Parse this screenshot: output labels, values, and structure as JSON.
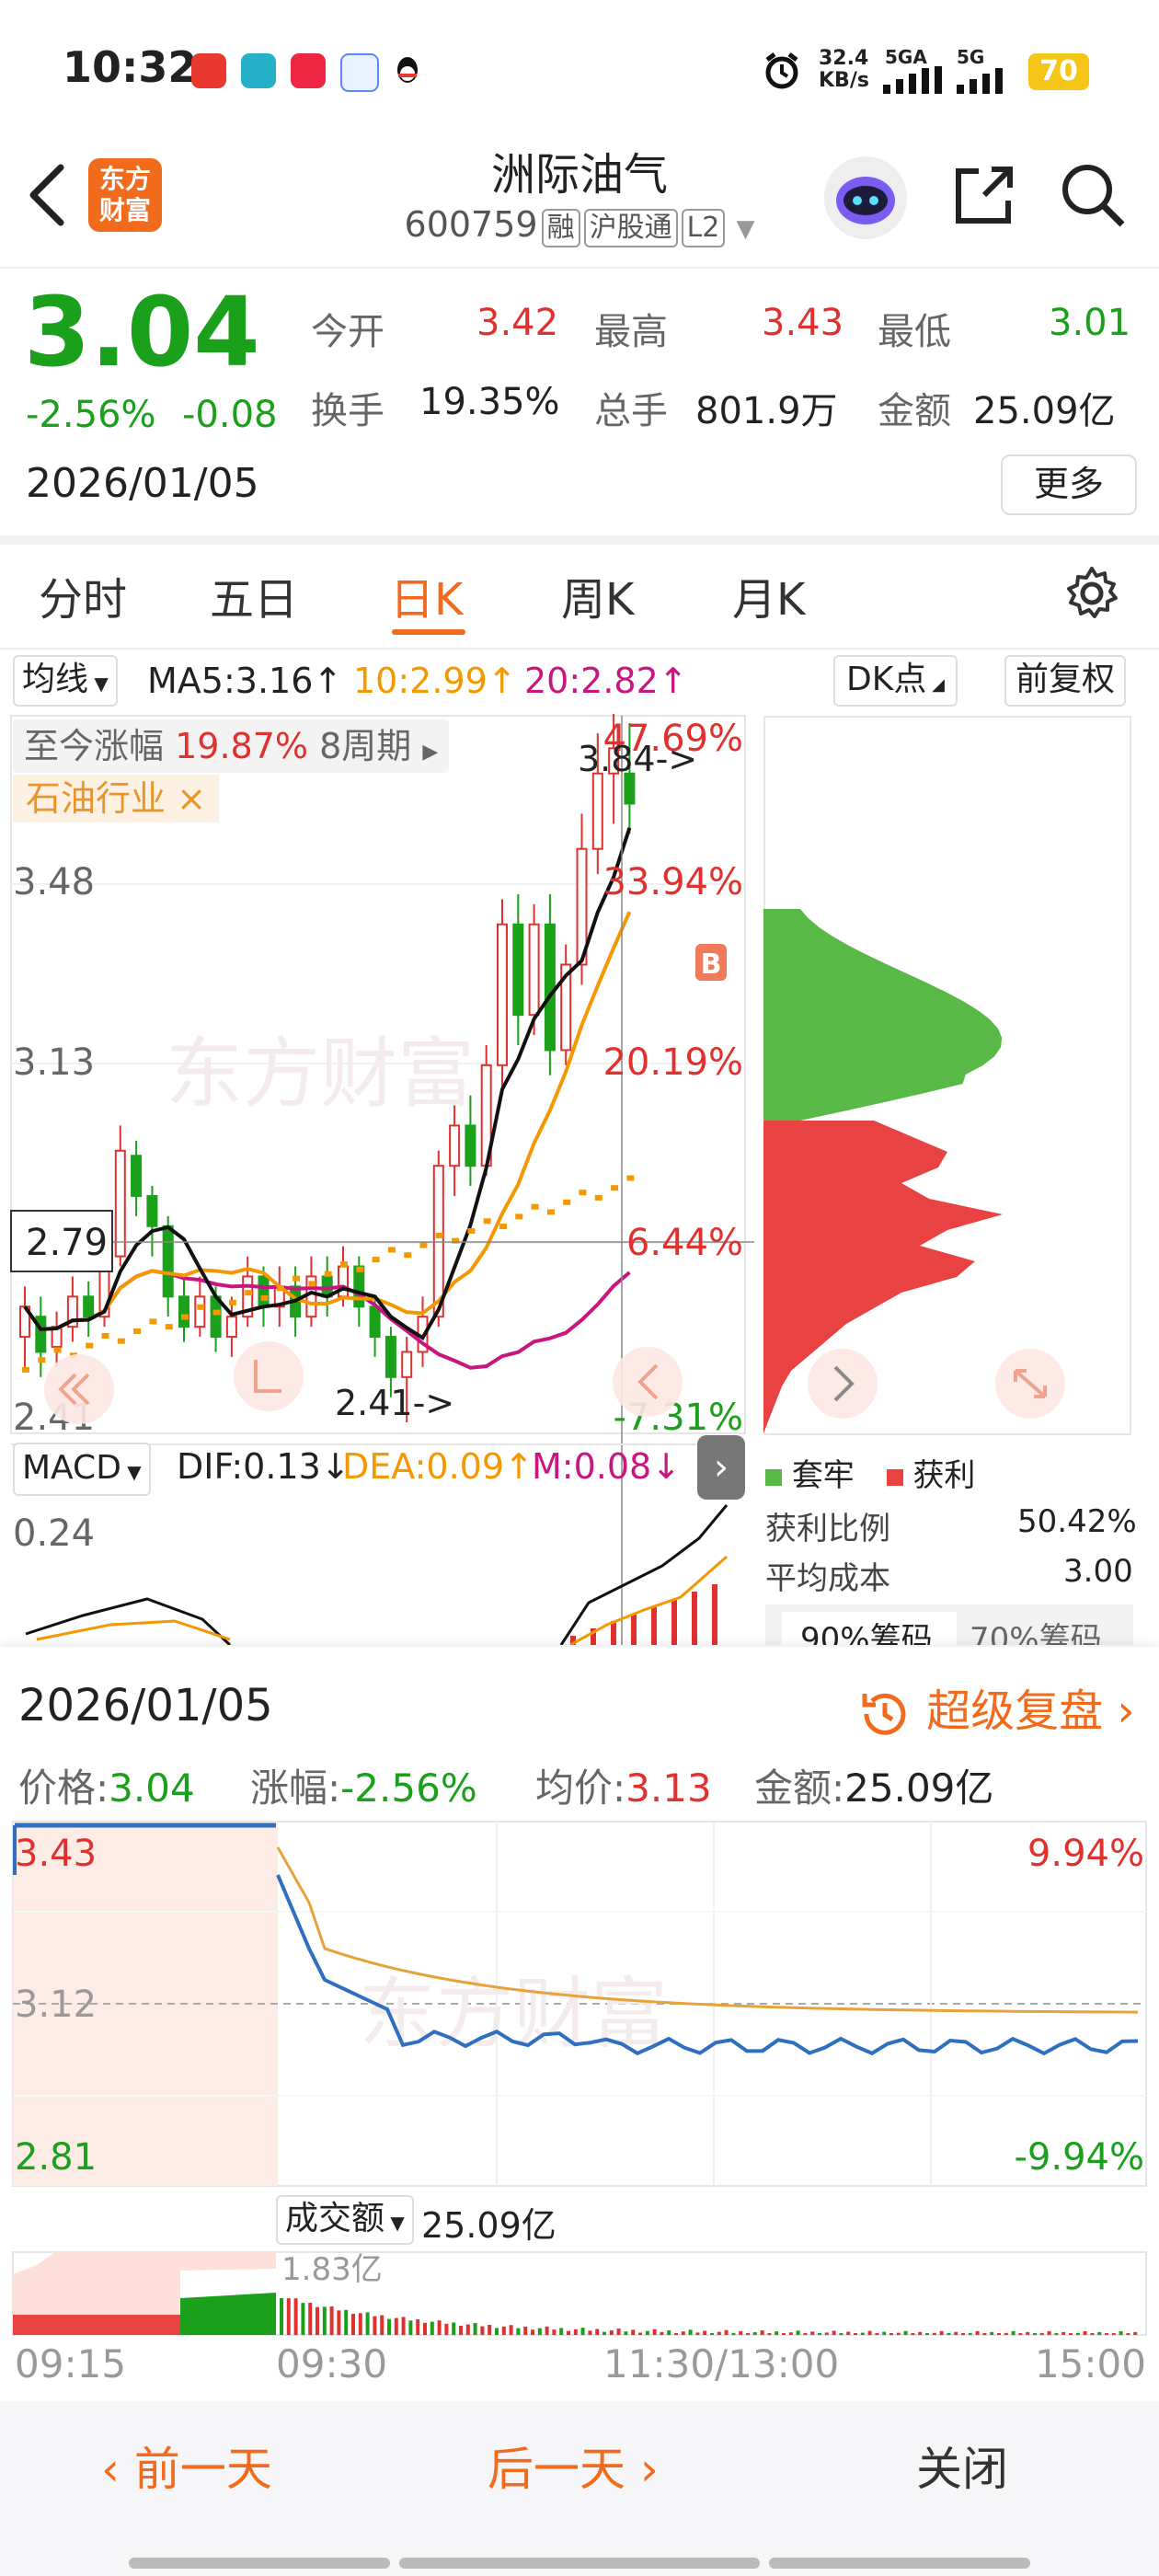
{
  "status_bar": {
    "time": "10:32",
    "net_speed_value": "32.4",
    "net_speed_unit": "KB/s",
    "sim1": "5GA",
    "sim2": "5G",
    "battery": "70"
  },
  "header": {
    "logo_line1": "东方",
    "logo_line2": "财富",
    "stock_name": "洲际油气",
    "stock_code": "600759",
    "tag_margin": "融",
    "tag_connect": "沪股通",
    "tag_level": "L2"
  },
  "quote": {
    "price": "3.04",
    "change_pct": "-2.56%",
    "change_amt": "-0.08",
    "date": "2026/01/05",
    "open_label": "今开",
    "open_value": "3.42",
    "high_label": "最高",
    "high_value": "3.43",
    "low_label": "最低",
    "low_value": "3.01",
    "turnover_label": "换手",
    "turnover_value": "19.35%",
    "volume_label": "总手",
    "volume_value": "801.9万",
    "amount_label": "金额",
    "amount_value": "25.09亿",
    "more_button": "更多"
  },
  "tabs": {
    "items": [
      "分时",
      "五日",
      "日K",
      "周K",
      "月K",
      "更多"
    ],
    "active": "日K"
  },
  "kline": {
    "ma_selector": "均线",
    "ma5": "MA5:3.16",
    "ma10": "10:2.99",
    "ma20": "20:2.82",
    "dk_button": "DK点",
    "adjust_button": "前复权",
    "range_label": "至今涨幅",
    "range_value": "19.87%",
    "period_label": "8周期",
    "industry_tag": "石油行业",
    "industry_close": "×",
    "y_labels": [
      "3.48",
      "3.13",
      "2.79",
      "2.41"
    ],
    "pct_labels": [
      "47.69%",
      "33.94%",
      "20.19%",
      "6.44%",
      "-7.31%"
    ],
    "high_marker": "3.84->",
    "low_marker": "2.41->",
    "b_marker": "B",
    "watermark": "东方财富",
    "macd_selector": "MACD",
    "dif": "DIF:0.13",
    "dea": "DEA:0.09",
    "m": "M:0.08",
    "macd_y": "0.24"
  },
  "chip": {
    "legend_trapped": "套牢",
    "legend_profit": "获利",
    "profit_ratio_label": "获利比例",
    "profit_ratio_value": "50.42%",
    "avg_cost_label": "平均成本",
    "avg_cost_value": "3.00",
    "tab_90": "90%筹码",
    "tab_70": "70%筹码"
  },
  "replay": {
    "date": "2026/01/05",
    "super_replay": "超级复盘",
    "price_label": "价格:",
    "price_value": "3.04",
    "change_label": "涨幅:",
    "change_value": "-2.56%",
    "avg_label": "均价:",
    "avg_value": "3.13",
    "amount_label": "金额:",
    "amount_value": "25.09亿",
    "y_top": "3.43",
    "y_mid": "3.12",
    "y_bottom": "2.81",
    "pct_top": "9.94%",
    "pct_bottom": "-9.94%",
    "volume_selector": "成交额",
    "volume_total": "25.09亿",
    "volume_max": "1.83亿",
    "times": [
      "09:15",
      "09:30",
      "11:30/13:00",
      "15:00"
    ]
  },
  "footer": {
    "prev_day": "前一天",
    "next_day": "后一天",
    "close": "关闭"
  },
  "colors": {
    "up": "#e0312f",
    "down": "#1aa01a",
    "accent": "#f26a1b",
    "ma5": "#111111",
    "ma10": "#f39800",
    "ma20": "#c8157f"
  }
}
